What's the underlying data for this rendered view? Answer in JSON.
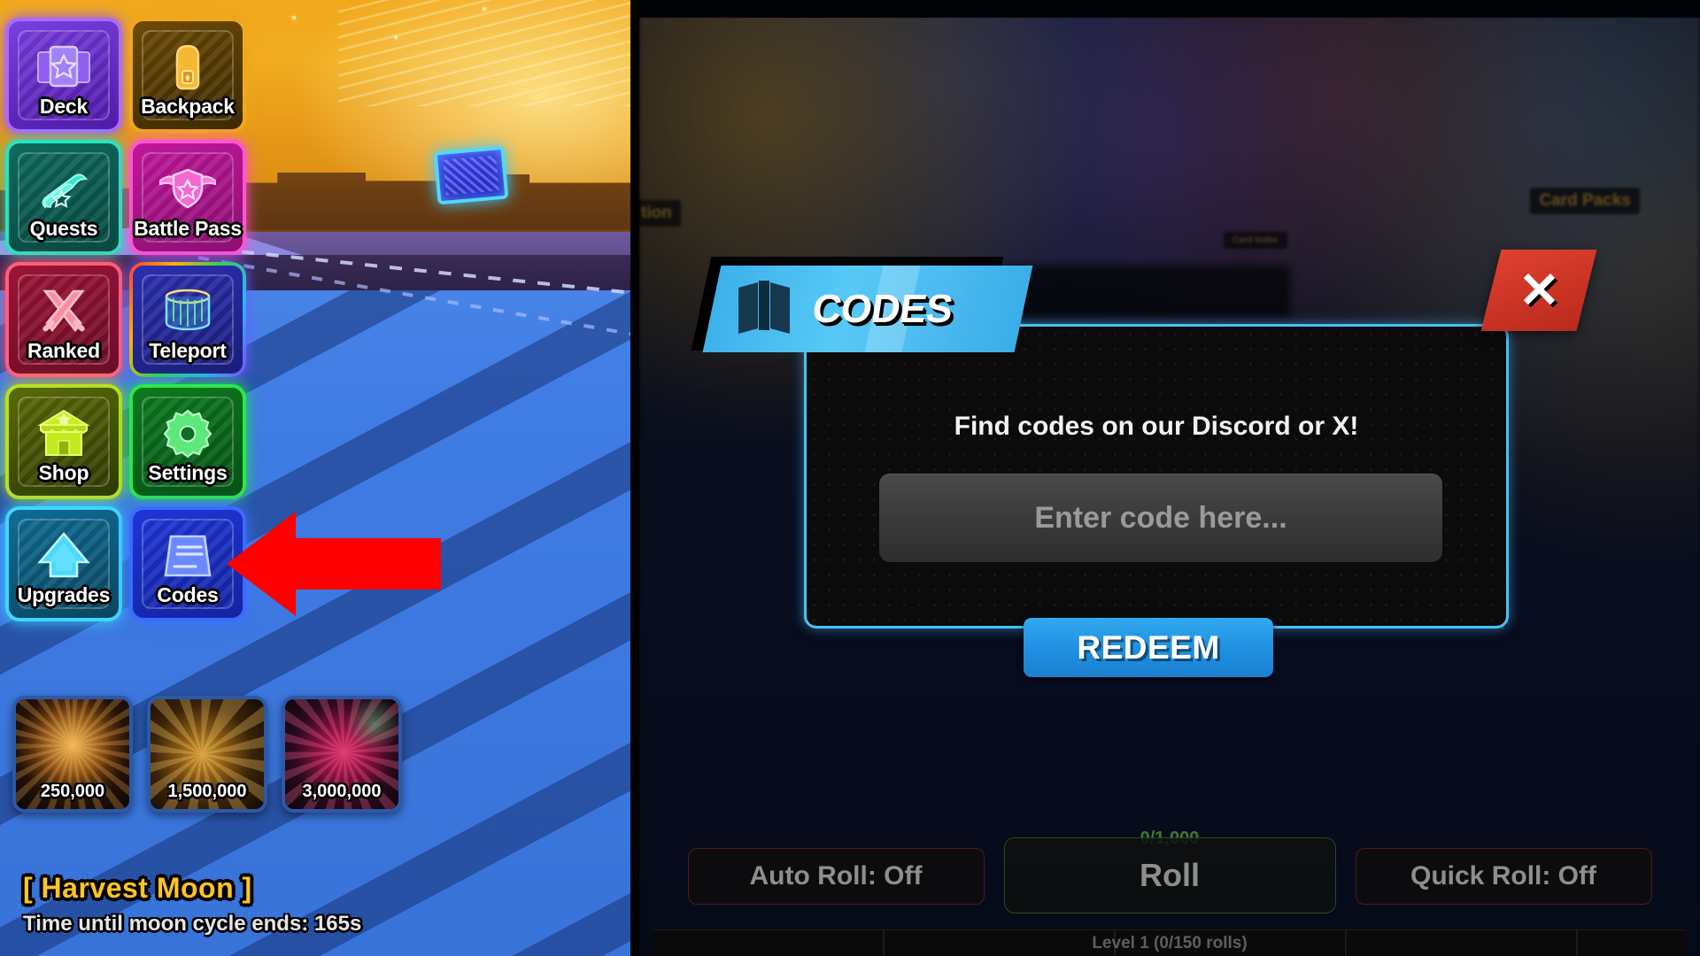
{
  "left_panel": {
    "menu_buttons": [
      {
        "label": "Deck",
        "icon": "card-deck-icon"
      },
      {
        "label": "Backpack",
        "icon": "backpack-icon"
      },
      {
        "label": "Quests",
        "icon": "scroll-icon"
      },
      {
        "label": "Battle Pass",
        "icon": "winged-shield-icon"
      },
      {
        "label": "Ranked",
        "icon": "crossed-swords-icon"
      },
      {
        "label": "Teleport",
        "icon": "portal-icon"
      },
      {
        "label": "Shop",
        "icon": "shop-house-icon"
      },
      {
        "label": "Settings",
        "icon": "gear-icon"
      },
      {
        "label": "Upgrades",
        "icon": "up-arrow-icon"
      },
      {
        "label": "Codes",
        "icon": "code-page-icon"
      }
    ],
    "cards": [
      {
        "value": "250,000"
      },
      {
        "value": "1,500,000"
      },
      {
        "value": "3,000,000"
      }
    ],
    "moon_event": {
      "title": "[ Harvest Moon ]",
      "subtitle": "Time until moon cycle ends: 165s",
      "title_color": "#ffc425"
    },
    "annotation": {
      "arrow": "red-left-arrow",
      "color": "#ff0000"
    }
  },
  "right_panel": {
    "background_chips": {
      "card_packs": "Card Packs",
      "collection": "tion",
      "small_chip": "Card Index"
    },
    "modal": {
      "title": "CODES",
      "title_icon": "open-book-icon",
      "close_label": "✕",
      "hint": "Find codes on our Discord or X!",
      "input_placeholder": "Enter code here...",
      "input_value": "",
      "redeem_label": "REDEEM",
      "accent_color": "#49c2f2",
      "close_color": "#d8392a",
      "redeem_color": "#1f8fe0"
    },
    "bottom_bar": {
      "roll_counter": "0/1,000",
      "auto_roll_label": "Auto Roll: Off",
      "roll_label": "Roll",
      "quick_roll_label": "Quick Roll: Off",
      "xp_text": "Level 1 (0/150 rolls)"
    },
    "annotation": {
      "arrow": "red-up-arrow",
      "color": "#ff0000"
    }
  }
}
